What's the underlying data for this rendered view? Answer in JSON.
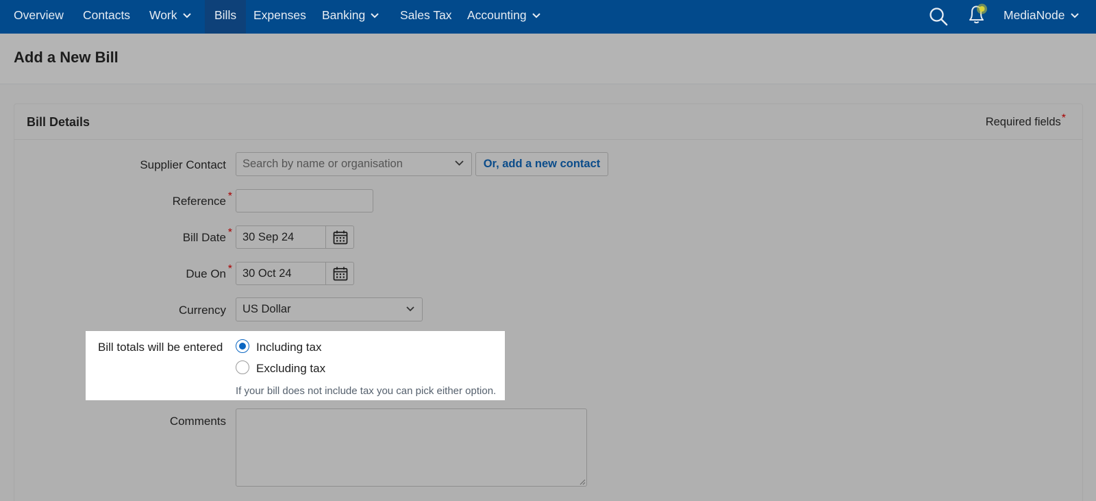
{
  "nav": {
    "items": [
      {
        "label": "Overview",
        "has_dropdown": false,
        "active": false
      },
      {
        "label": "Contacts",
        "has_dropdown": false,
        "active": false
      },
      {
        "label": "Work",
        "has_dropdown": true,
        "active": false
      },
      {
        "label": "Bills",
        "has_dropdown": false,
        "active": true
      },
      {
        "label": "Expenses",
        "has_dropdown": false,
        "active": false
      },
      {
        "label": "Banking",
        "has_dropdown": true,
        "active": false
      },
      {
        "label": "Sales Tax",
        "has_dropdown": false,
        "active": false
      },
      {
        "label": "Accounting",
        "has_dropdown": true,
        "active": false
      }
    ],
    "search_icon": "search-icon",
    "notification_icon": "bell-icon",
    "account_label": "MediaNode"
  },
  "page": {
    "title": "Add a New Bill"
  },
  "card": {
    "title": "Bill Details",
    "required_note": "Required fields",
    "required_marker": "*"
  },
  "form": {
    "supplier": {
      "label": "Supplier Contact",
      "placeholder": "Search by name or organisation",
      "add_contact_label": "Or, add a new contact"
    },
    "reference": {
      "label": "Reference",
      "value": ""
    },
    "bill_date": {
      "label": "Bill Date",
      "value": "30 Sep 24"
    },
    "due_on": {
      "label": "Due On",
      "value": "30 Oct 24"
    },
    "currency": {
      "label": "Currency",
      "value": "US Dollar"
    },
    "totals": {
      "label": "Bill totals will be entered",
      "options": [
        {
          "label": "Including tax",
          "checked": true
        },
        {
          "label": "Excluding tax",
          "checked": false
        }
      ],
      "hint": "If your bill does not include tax you can pick either option."
    },
    "comments": {
      "label": "Comments",
      "value": ""
    }
  },
  "colors": {
    "nav_bg": "#024a8c",
    "radio_accent": "#0a66c2",
    "link": "#0b4c8a",
    "required": "#a80000"
  }
}
